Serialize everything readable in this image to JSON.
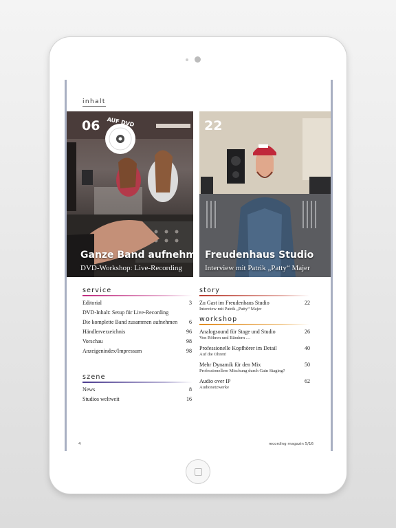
{
  "page": {
    "section_label": "inhalt",
    "footer_left": "4",
    "footer_right": "recording magazin 5/16"
  },
  "features": [
    {
      "page": "06",
      "badge": "AUF DVD",
      "title": "Ganze Band aufnehmen",
      "subtitle": "DVD-Workshop: Live-Recording"
    },
    {
      "page": "22",
      "title": "Freudenhaus Studio",
      "subtitle": "Interview mit Patrik „Patty“ Majer"
    }
  ],
  "service": {
    "title": "service",
    "items": [
      {
        "label": "Editorial",
        "page": "3"
      },
      {
        "label": "DVD-Inhalt: Setup für Live-Recording",
        "page": ""
      },
      {
        "label": "Die komplette Band zusammen aufnehmen",
        "page": "6"
      },
      {
        "label": "Händlerverzeichnis",
        "page": "96"
      },
      {
        "label": "Vorschau",
        "page": "98"
      },
      {
        "label": "Anzeigenindex/Impressum",
        "page": "98"
      }
    ]
  },
  "szene": {
    "title": "szene",
    "items": [
      {
        "label": "News",
        "page": "8"
      },
      {
        "label": "Studios weltweit",
        "page": "16"
      }
    ]
  },
  "story": {
    "title": "story",
    "items": [
      {
        "label": "Zu Gast im Freudenhaus Studio",
        "sub": "Interview mit Patrik „Patty“ Majer",
        "page": "22"
      }
    ]
  },
  "workshop": {
    "title": "workshop",
    "items": [
      {
        "label": "Analogsound für Stage und Studio",
        "sub": "Von Röhren und Bändern …",
        "page": "26"
      },
      {
        "label": "Professionelle Kopfhörer im Detail",
        "sub": "Auf die Ohren!",
        "page": "40"
      },
      {
        "label": "Mehr Dynamik für den Mix",
        "sub": "Professionellere Mischung durch Gain Staging?",
        "page": "50"
      },
      {
        "label": "Audio over IP",
        "sub": "Audionetzwerke",
        "page": "62"
      }
    ]
  },
  "colors": {
    "service": "#c02a7e",
    "szene": "#4a3a8e",
    "story": "#b83a2e",
    "workshop": "#e08a1e"
  }
}
